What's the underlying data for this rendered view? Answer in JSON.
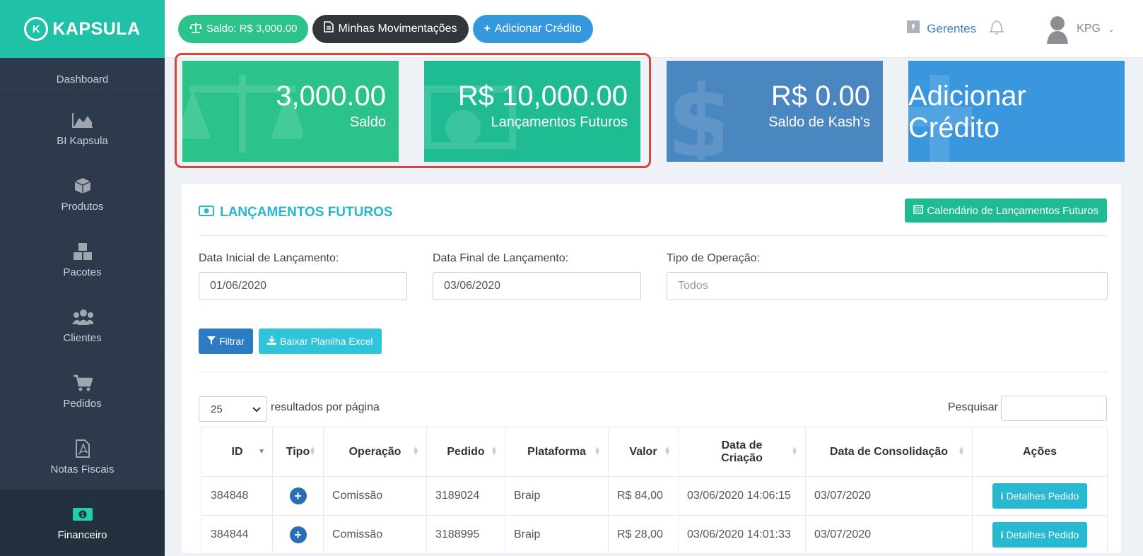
{
  "brand": {
    "name": "KAPSULA"
  },
  "sidebar": {
    "items": [
      {
        "label": "Dashboard",
        "icon": "dashboard-icon"
      },
      {
        "label": "BI Kapsula",
        "icon": "area-chart-icon"
      },
      {
        "label": "Produtos",
        "icon": "cube-icon"
      },
      {
        "label": "Pacotes",
        "icon": "cubes-icon"
      },
      {
        "label": "Clientes",
        "icon": "users-icon"
      },
      {
        "label": "Pedidos",
        "icon": "cart-icon"
      },
      {
        "label": "Notas Fiscais",
        "icon": "file-pdf-icon"
      },
      {
        "label": "Financeiro",
        "icon": "money-icon",
        "active": true
      }
    ]
  },
  "topbar": {
    "saldo_pill": "Saldo: R$ 3,000.00",
    "movimentacoes": "Minhas Movimentações",
    "adicionar": "Adicionar Crédito",
    "gerentes": "Gerentes",
    "user": "KPG"
  },
  "cards": [
    {
      "value": "3,000.00",
      "label": "Saldo",
      "color": "#2bc38a"
    },
    {
      "value": "R$ 10,000.00",
      "label": "Lançamentos Futuros",
      "color": "#1fbc93"
    },
    {
      "value": "R$ 0.00",
      "label": "Saldo de Kash's",
      "color": "#4a86c0"
    },
    {
      "value": "Adicionar Crédito",
      "label": "",
      "color": "#3a96dd"
    }
  ],
  "panel": {
    "title": "LANÇAMENTOS FUTUROS",
    "calendar_button": "Calendário de Lançamentos Futuros",
    "filters": {
      "start_label": "Data Inicial de Lançamento:",
      "start_value": "01/06/2020",
      "end_label": "Data Final de Lançamento:",
      "end_value": "03/06/2020",
      "type_label": "Tipo de Operação:",
      "type_placeholder": "Todos"
    },
    "filter_button": "Filtrar",
    "excel_button": "Baixar Planilha Excel",
    "page_size": "25",
    "per_page_label": "resultados por página",
    "search_label": "Pesquisar"
  },
  "table": {
    "headers": [
      "ID",
      "Tipo",
      "Operação",
      "Pedido",
      "Plataforma",
      "Valor",
      "Data de Criação",
      "Data de Consolidação",
      "Ações"
    ],
    "rows": [
      {
        "id": "384848",
        "operacao": "Comissão",
        "pedido": "3189024",
        "plataforma": "Braip",
        "valor": "R$ 84,00",
        "criacao": "03/06/2020 14:06:15",
        "consolidacao": "03/07/2020",
        "acao": "Detalhes Pedido"
      },
      {
        "id": "384844",
        "operacao": "Comissão",
        "pedido": "3188995",
        "plataforma": "Braip",
        "valor": "R$ 28,00",
        "criacao": "03/06/2020 14:01:33",
        "consolidacao": "03/07/2020",
        "acao": "Detalhes Pedido"
      }
    ]
  }
}
